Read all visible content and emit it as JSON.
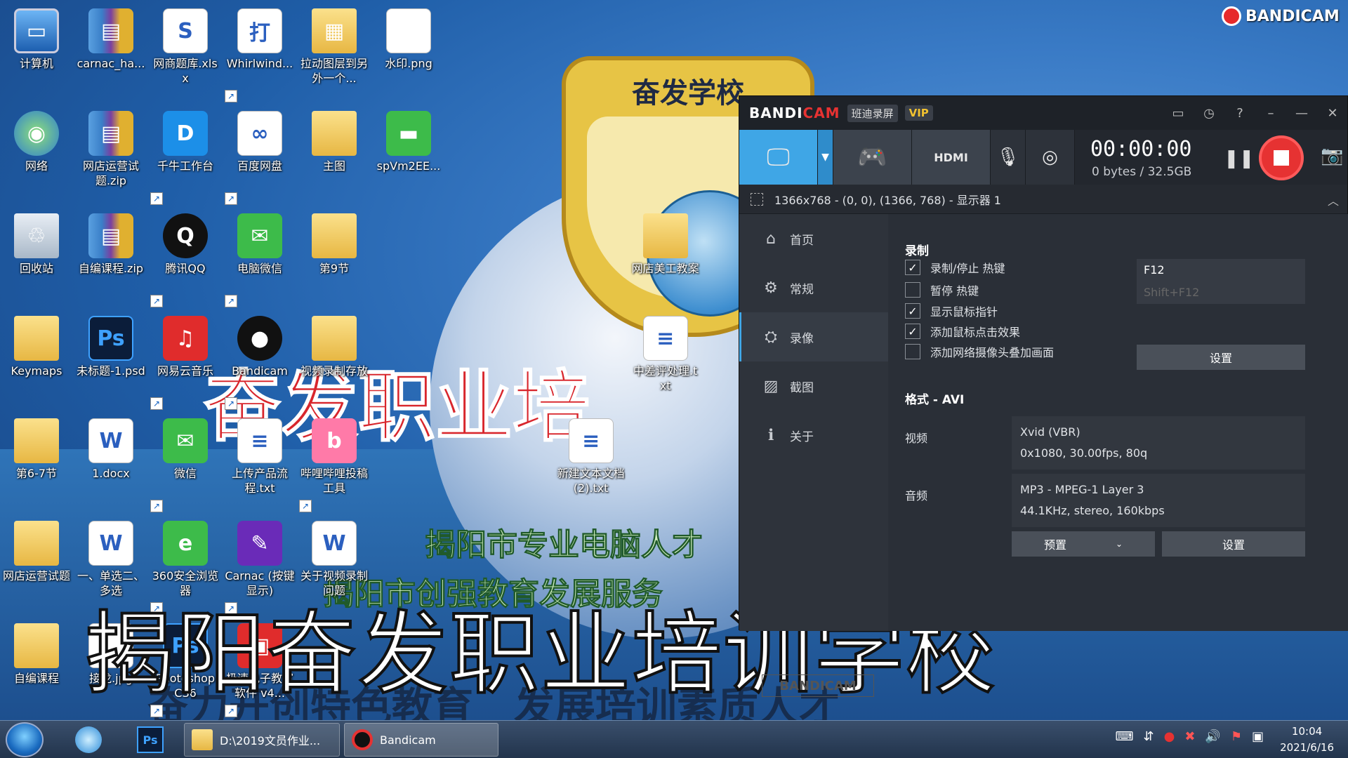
{
  "desktop": {
    "icons": [
      {
        "label": "计算机",
        "type": "pc",
        "glyph": "▭",
        "shortcut": false
      },
      {
        "label": "carnac_ha...",
        "type": "winrar",
        "glyph": "▤",
        "shortcut": false
      },
      {
        "label": "网商题库.xlsx",
        "type": "doc",
        "glyph": "S",
        "shortcut": false
      },
      {
        "label": "Whirlwind...",
        "type": "doc",
        "glyph": "打",
        "shortcut": true
      },
      {
        "label": "拉动图层到另外一个...",
        "type": "folder",
        "glyph": "▦",
        "shortcut": false
      },
      {
        "label": "水印.png",
        "type": "doc",
        "glyph": "",
        "shortcut": false
      },
      {
        "label": "网络",
        "type": "net",
        "glyph": "◉",
        "shortcut": false
      },
      {
        "label": "网店运营试题.zip",
        "type": "winrar",
        "glyph": "▤",
        "shortcut": false
      },
      {
        "label": "千牛工作台",
        "type": "blue",
        "glyph": "D",
        "shortcut": true
      },
      {
        "label": "百度网盘",
        "type": "doc",
        "glyph": "∞",
        "shortcut": true
      },
      {
        "label": "主图",
        "type": "folder",
        "glyph": "",
        "shortcut": false
      },
      {
        "label": "spVm2EE...",
        "type": "green",
        "glyph": "▬",
        "shortcut": false
      },
      {
        "label": "回收站",
        "type": "bin",
        "glyph": "♲",
        "shortcut": false
      },
      {
        "label": "自编课程.zip",
        "type": "winrar",
        "glyph": "▤",
        "shortcut": false
      },
      {
        "label": "腾讯QQ",
        "type": "black",
        "glyph": "Q",
        "shortcut": true
      },
      {
        "label": "电脑微信",
        "type": "green",
        "glyph": "✉",
        "shortcut": true
      },
      {
        "label": "第9节",
        "type": "folder",
        "glyph": "",
        "shortcut": false
      },
      {
        "label": "Keymaps",
        "type": "folder",
        "glyph": "",
        "shortcut": false
      },
      {
        "label": "未标题-1.psd",
        "type": "ps",
        "glyph": "Ps",
        "shortcut": false
      },
      {
        "label": "网易云音乐",
        "type": "red",
        "glyph": "♫",
        "shortcut": true
      },
      {
        "label": "Bandicam",
        "type": "black",
        "glyph": "●",
        "shortcut": true
      },
      {
        "label": "视频录制存放",
        "type": "folder",
        "glyph": "",
        "shortcut": false
      },
      {
        "label": "第6-7节",
        "type": "folder",
        "glyph": "",
        "shortcut": false
      },
      {
        "label": "1.docx",
        "type": "doc",
        "glyph": "W",
        "shortcut": false
      },
      {
        "label": "微信",
        "type": "green",
        "glyph": "✉",
        "shortcut": true
      },
      {
        "label": "上传产品流程.txt",
        "type": "doc",
        "glyph": "≡",
        "shortcut": false
      },
      {
        "label": "哔哩哔哩投稿工具",
        "type": "pink",
        "glyph": "b",
        "shortcut": true
      },
      {
        "label": "网店运营试题",
        "type": "folder",
        "glyph": "",
        "shortcut": false
      },
      {
        "label": "一、单选二、多选",
        "type": "doc",
        "glyph": "W",
        "shortcut": false
      },
      {
        "label": "360安全浏览器",
        "type": "green",
        "glyph": "e",
        "shortcut": true
      },
      {
        "label": "Carnac (按键显示)",
        "type": "purple",
        "glyph": "✎",
        "shortcut": true
      },
      {
        "label": "关于视频录制问题",
        "type": "doc",
        "glyph": "W",
        "shortcut": false
      },
      {
        "label": "自编课程",
        "type": "folder",
        "glyph": "",
        "shortcut": false
      },
      {
        "label": "接龙.jpg",
        "type": "doc",
        "glyph": "",
        "shortcut": false
      },
      {
        "label": "Photoshop CS6",
        "type": "ps",
        "glyph": "Ps",
        "shortcut": true
      },
      {
        "label": "极速电子教室软件 v4...",
        "type": "red",
        "glyph": "▣",
        "shortcut": true
      },
      {
        "label": "网店美工教案",
        "type": "folder",
        "glyph": "",
        "shortcut": false
      },
      {
        "label": "中差评处理.txt",
        "type": "doc",
        "glyph": "≡",
        "shortcut": false
      },
      {
        "label": "新建文本文档 (2).txt",
        "type": "doc",
        "glyph": "≡",
        "shortcut": false
      }
    ],
    "wallpaper": {
      "badge_title": "奋发学校",
      "big_red": "奋发职业培",
      "green_line1": "揭阳市专业电脑人才",
      "green_line2": "揭阳市创强教育发展服务",
      "bottom_ink": "奋力开创特色教育　发展培训素质人才"
    },
    "caption": "揭阳奋发职业培训学校"
  },
  "bandicam_logo": "BANDICAM",
  "window": {
    "brand_a": "BANDI",
    "brand_b": "CAM",
    "brand_cn": "班迪录屏",
    "vip": "VIP",
    "title_buttons": [
      "▭",
      "◷",
      "?",
      "–",
      "—",
      "✕"
    ],
    "timer": "00:00:00",
    "bytes": "0 bytes / 32.5GB",
    "region": "1366x768 - (0, 0), (1366, 768) - 显示器 1",
    "nav": [
      {
        "label": "首页",
        "icon": "⌂"
      },
      {
        "label": "常规",
        "icon": "⚙"
      },
      {
        "label": "录像",
        "icon": "⛭"
      },
      {
        "label": "截图",
        "icon": "▨"
      },
      {
        "label": "关于",
        "icon": "ℹ"
      }
    ],
    "sidelogo": "BANDICAM",
    "record_section": "录制",
    "options": [
      {
        "label": "录制/停止 热键",
        "checked": "✓"
      },
      {
        "label": "暂停 热键",
        "checked": ""
      },
      {
        "label": "显示鼠标指针",
        "checked": "✓"
      },
      {
        "label": "添加鼠标点击效果",
        "checked": "✓"
      },
      {
        "label": "添加网络摄像头叠加画面",
        "checked": ""
      }
    ],
    "hotkey_record": "F12",
    "hotkey_pause": "Shift+F12",
    "settings_label": "设置",
    "format_section": "格式 - AVI",
    "video_label": "视频",
    "video_line1": "Xvid (VBR)",
    "video_line2": "0x1080, 30.00fps, 80q",
    "audio_label": "音频",
    "audio_line1": "MP3 - MPEG-1 Layer 3",
    "audio_line2": "44.1KHz, stereo, 160kbps",
    "preset_label": "预置",
    "settings2_label": "设置"
  },
  "taskbar": {
    "explorer_task": "D:\\2019文员作业...",
    "bandicam_task": "Bandicam",
    "ps_label": "Ps",
    "time": "10:04",
    "date": "2021/6/16"
  }
}
